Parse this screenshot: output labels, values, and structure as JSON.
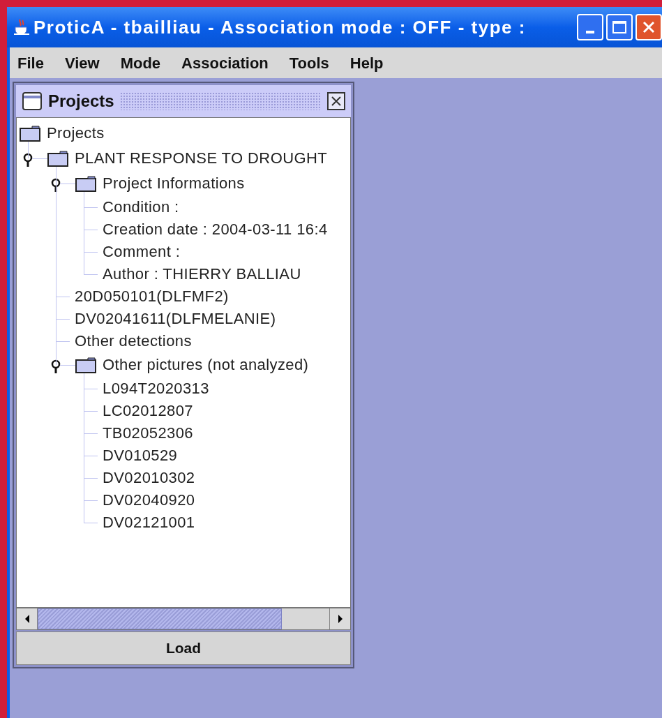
{
  "window": {
    "title": "ProticA - tbailliau - Association mode : OFF - type :"
  },
  "menu": [
    "File",
    "View",
    "Mode",
    "Association",
    "Tools",
    "Help"
  ],
  "projects_panel": {
    "title": "Projects",
    "tree": {
      "label": "Projects",
      "kind": "folder",
      "children": [
        {
          "label": "PLANT RESPONSE TO DROUGHT",
          "kind": "folder",
          "expanded": true,
          "children": [
            {
              "label": "Project Informations",
              "kind": "folder",
              "expanded": true,
              "children": [
                {
                  "label": "Condition :",
                  "kind": "leaf"
                },
                {
                  "label": "Creation date : 2004-03-11 16:4",
                  "kind": "leaf"
                },
                {
                  "label": "Comment :",
                  "kind": "leaf"
                },
                {
                  "label": "Author : THIERRY BALLIAU",
                  "kind": "leaf"
                }
              ]
            },
            {
              "label": "20D050101(DLFMF2)",
              "kind": "leaf"
            },
            {
              "label": "DV02041611(DLFMELANIE)",
              "kind": "leaf"
            },
            {
              "label": "Other detections",
              "kind": "leaf"
            },
            {
              "label": "Other pictures (not analyzed)",
              "kind": "folder",
              "expanded": true,
              "children": [
                {
                  "label": "L094T2020313",
                  "kind": "leaf"
                },
                {
                  "label": "LC02012807",
                  "kind": "leaf"
                },
                {
                  "label": "TB02052306",
                  "kind": "leaf"
                },
                {
                  "label": "DV010529",
                  "kind": "leaf"
                },
                {
                  "label": "DV02010302",
                  "kind": "leaf"
                },
                {
                  "label": "DV02040920",
                  "kind": "leaf"
                },
                {
                  "label": "DV02121001",
                  "kind": "leaf"
                }
              ]
            }
          ]
        }
      ]
    },
    "button": "Load"
  }
}
